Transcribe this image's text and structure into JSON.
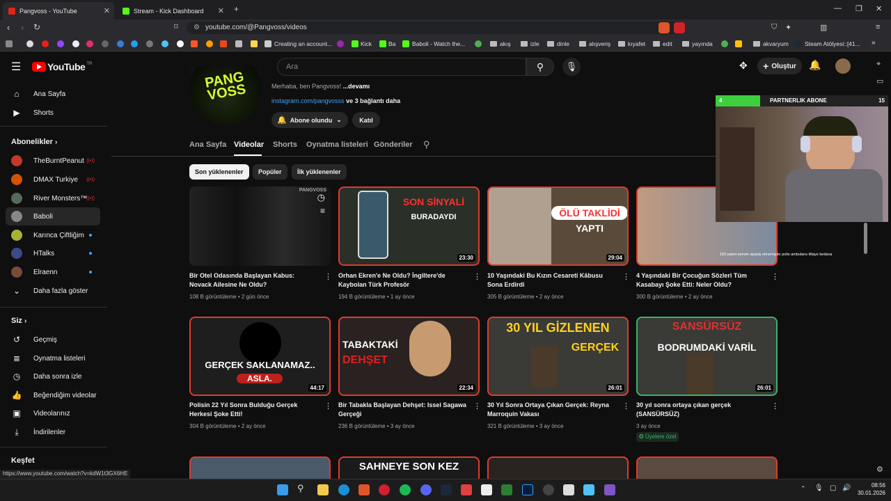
{
  "browser": {
    "tabs": [
      {
        "label": "Pangvoss - YouTube",
        "active": true
      },
      {
        "label": "Stream - Kick Dashboard",
        "active": false
      }
    ],
    "url": "youtube.com/@Pangvoss/videos",
    "status_url": "https://www.youtube.com/watch?v=kdW1t3GX6HE",
    "bookmarks": [
      "Creating an account...",
      "Kick",
      "Ba",
      "Baboli - Watch the...",
      "akış",
      "izle",
      "dinle",
      "alışveriş",
      "kıyafet",
      "edit",
      "yayında",
      "akvaryum",
      "Steam Atölyesi::[41..."
    ]
  },
  "youtube": {
    "logo": "YouTube",
    "logo_country": "TR",
    "search_placeholder": "Ara",
    "create_label": "Oluştur"
  },
  "sidebar": {
    "main": [
      {
        "label": "Ana Sayfa",
        "icon": "home-icon"
      },
      {
        "label": "Shorts",
        "icon": "shorts-icon"
      }
    ],
    "subs_heading": "Abonelikler",
    "subs": [
      {
        "label": "TheBurntPeanut",
        "status": "live",
        "color": "#c0392b"
      },
      {
        "label": "DMAX Turkiye",
        "status": "live",
        "color": "#d35400"
      },
      {
        "label": "River Monsters™",
        "status": "live",
        "color": "#556b5a"
      },
      {
        "label": "Baboli",
        "status": "",
        "color": "#888"
      },
      {
        "label": "Karınca Çiftliğim",
        "status": "dot",
        "color": "#a7b23a"
      },
      {
        "label": "HTalks",
        "status": "dot",
        "color": "#3a4a8a"
      },
      {
        "label": "Elraenn",
        "status": "dot",
        "color": "#7a4a3a"
      }
    ],
    "show_more": "Daha fazla göster",
    "you_heading": "Siz",
    "you": [
      {
        "label": "Geçmiş",
        "icon": "history-icon"
      },
      {
        "label": "Oynatma listeleri",
        "icon": "playlist-icon"
      },
      {
        "label": "Daha sonra izle",
        "icon": "clock-icon"
      },
      {
        "label": "Beğendiğim videolar",
        "icon": "like-icon"
      },
      {
        "label": "Videolarınız",
        "icon": "video-icon"
      },
      {
        "label": "İndirilenler",
        "icon": "download-icon"
      }
    ],
    "explore_heading": "Keşfet"
  },
  "channel": {
    "description": "Merhaba, ben Pangvoss!",
    "more": "...devamı",
    "link": "instagram.com/pangvosss",
    "link_more": "ve 3 bağlantı daha",
    "subscribed": "Abone olundu",
    "join": "Katıl",
    "avatar_text": "PANG VOSS",
    "tabs": [
      "Ana Sayfa",
      "Videolar",
      "Shorts",
      "Oynatma listeleri",
      "Gönderiler"
    ],
    "active_tab": "Videolar",
    "chips": [
      "Son yüklenenler",
      "Popüler",
      "İlk yüklenenler"
    ]
  },
  "videos": [
    {
      "title": "Bir Otel Odasında Başlayan Kabus: Novack Ailesine Ne Oldu?",
      "meta": "108 B görüntüleme • 2 gün önce",
      "duration": "",
      "overlay": "",
      "border": "#222",
      "bg": "#1a1a1a"
    },
    {
      "title": "Orhan Ekren'e Ne Oldu? İngiltere'de Kaybolan Türk Profesör",
      "meta": "194 B görüntüleme • 1 ay önce",
      "duration": "23:30",
      "overlay": "SON SİNYALİ\nBURADAYDI",
      "border": "#e03a2f",
      "bg": "#2a3028"
    },
    {
      "title": "10 Yaşındaki Bu Kızın Cesareti Kâbusu Sona Erdirdi",
      "meta": "305 B görüntüleme • 2 ay önce",
      "duration": "29:04",
      "overlay": "ÖLÜ TAKLİDİ\nYAPTI",
      "border": "#e03a2f",
      "bg": "#5a4a3a"
    },
    {
      "title": "4 Yaşındaki Bir Çocuğun Sözleri Tüm Kasabayı Şoke Etti: Neler Oldu?",
      "meta": "300 B görüntüleme • 2 ay önce",
      "duration": "",
      "overlay": "",
      "border": "#e03a2f",
      "bg": "#6a4a3a"
    },
    {
      "title": "Polisin 22 Yıl Sonra Bulduğu Gerçek Herkesi Şoke Etti!",
      "meta": "304 B görüntüleme • 2 ay önce",
      "duration": "44:17",
      "overlay": "GERÇEK SAKLANAMAZ..\nASLA.",
      "border": "#e03a2f",
      "bg": "#1e1e1e"
    },
    {
      "title": "Bir Tabakla Başlayan Dehşet: Issei Sagawa Gerçeği",
      "meta": "236 B görüntüleme • 3 ay önce",
      "duration": "22:34",
      "overlay": "TABAKTAKİ\nDEHŞET",
      "border": "#e03a2f",
      "bg": "#2a2220"
    },
    {
      "title": "30 Yıl Sonra Ortaya Çıkan Gerçek: Reyna Marroquín Vakası",
      "meta": "321 B görüntüleme • 3 ay önce",
      "duration": "26:01",
      "overlay": "30 YIL GİZLENEN\nGERÇEK",
      "border": "#e03a2f",
      "bg": "#3a3a36"
    },
    {
      "title": "30 yıl sonra ortaya çıkan gerçek (SANSÜRSÜZ)",
      "meta": "3 ay önce",
      "duration": "26:01",
      "overlay": "SANSÜRSÜZ\nBODRUMDAKİ VARİL",
      "border": "#3bb36b",
      "bg": "#3a3a36",
      "badge": "Üyelere özel"
    }
  ],
  "row3_overlay": "SAHNEYE SON KEZ",
  "stream": {
    "label": "PARTNERLIK ABONE",
    "left_num": "4",
    "right_num": "15",
    "progress": 0.26,
    "ticker": "150 paket yemek sipariş etmemişler polis ambulans itfaiye bedava"
  },
  "taskbar": {
    "time": "08:56",
    "date": "30.01.2026"
  }
}
